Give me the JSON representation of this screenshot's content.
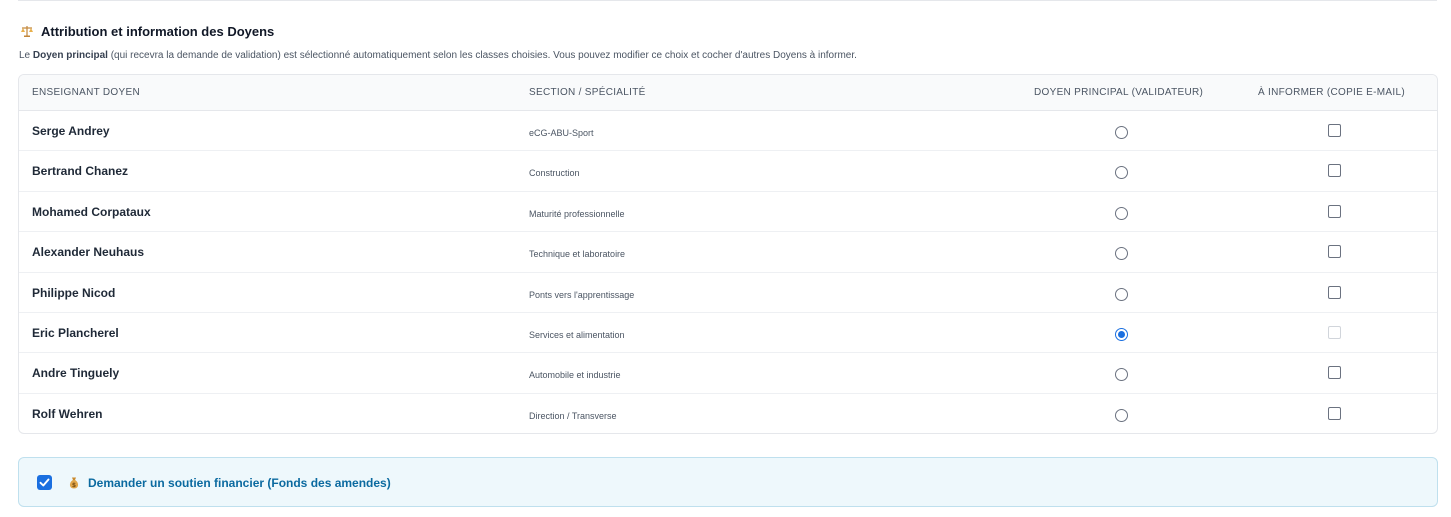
{
  "section": {
    "title": "Attribution et information des Doyens",
    "intro_prefix": "Le ",
    "intro_bold": "Doyen principal",
    "intro_suffix": " (qui recevra la demande de validation) est sélectionné automatiquement selon les classes choisies. Vous pouvez modifier ce choix et cocher d'autres Doyens à informer."
  },
  "table": {
    "headers": {
      "teacher": "ENSEIGNANT DOYEN",
      "section": "SECTION / SPÉCIALITÉ",
      "principal": "DOYEN PRINCIPAL (VALIDATEUR)",
      "inform": "À INFORMER (COPIE E-MAIL)"
    },
    "rows": [
      {
        "name": "Serge Andrey",
        "section": "eCG-ABU-Sport",
        "principal": false,
        "inform": false,
        "inform_disabled": false
      },
      {
        "name": "Bertrand Chanez",
        "section": "Construction",
        "principal": false,
        "inform": false,
        "inform_disabled": false
      },
      {
        "name": "Mohamed Corpataux",
        "section": "Maturité professionnelle",
        "principal": false,
        "inform": false,
        "inform_disabled": false
      },
      {
        "name": "Alexander Neuhaus",
        "section": "Technique et laboratoire",
        "principal": false,
        "inform": false,
        "inform_disabled": false
      },
      {
        "name": "Philippe Nicod",
        "section": "Ponts vers l'apprentissage",
        "principal": false,
        "inform": false,
        "inform_disabled": false
      },
      {
        "name": "Eric Plancherel",
        "section": "Services et alimentation",
        "principal": true,
        "inform": false,
        "inform_disabled": true
      },
      {
        "name": "Andre Tinguely",
        "section": "Automobile et industrie",
        "principal": false,
        "inform": false,
        "inform_disabled": false
      },
      {
        "name": "Rolf Wehren",
        "section": "Direction / Transverse",
        "principal": false,
        "inform": false,
        "inform_disabled": false
      }
    ]
  },
  "financial": {
    "checked": true,
    "label": "Demander un soutien financier (Fonds des amendes)"
  },
  "colors": {
    "accent": "#1a6fe0",
    "financial_text": "#0b6aa0",
    "financial_bg": "#eef8fc"
  },
  "icons": {
    "section": "balance-scale-icon",
    "financial": "money-bag-icon"
  }
}
